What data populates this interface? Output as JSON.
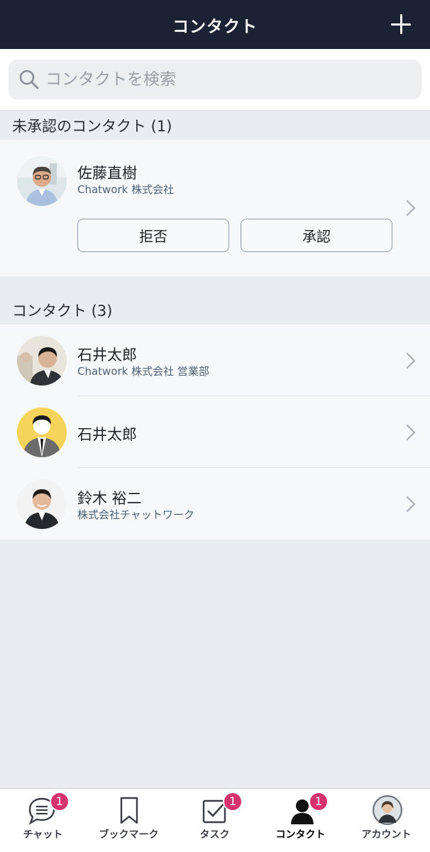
{
  "header": {
    "title": "コンタクト"
  },
  "search": {
    "placeholder": "コンタクトを検索"
  },
  "pending": {
    "section_title": "未承認のコンタクト (1)",
    "items": [
      {
        "name": "佐藤直樹",
        "company": "Chatwork 株式会社",
        "reject_label": "拒否",
        "approve_label": "承認"
      }
    ]
  },
  "contacts": {
    "section_title": "コンタクト (3)",
    "items": [
      {
        "name": "石井太郎",
        "company": "Chatwork 株式会社 営業部"
      },
      {
        "name": "石井太郎",
        "company": ""
      },
      {
        "name": "鈴木 裕二",
        "company": "株式会社チャットワーク"
      }
    ]
  },
  "tabbar": {
    "tabs": [
      {
        "label": "チャット",
        "badge": "1",
        "icon": "chat-icon"
      },
      {
        "label": "ブックマーク",
        "badge": "",
        "icon": "bookmark-icon"
      },
      {
        "label": "タスク",
        "badge": "1",
        "icon": "task-icon"
      },
      {
        "label": "コンタクト",
        "badge": "1",
        "icon": "contact-icon",
        "active": true
      },
      {
        "label": "アカウント",
        "badge": "",
        "icon": "account-avatar"
      }
    ]
  },
  "colors": {
    "header_bg": "#1b2233",
    "badge": "#d6336c",
    "link_text": "#4f6275"
  }
}
